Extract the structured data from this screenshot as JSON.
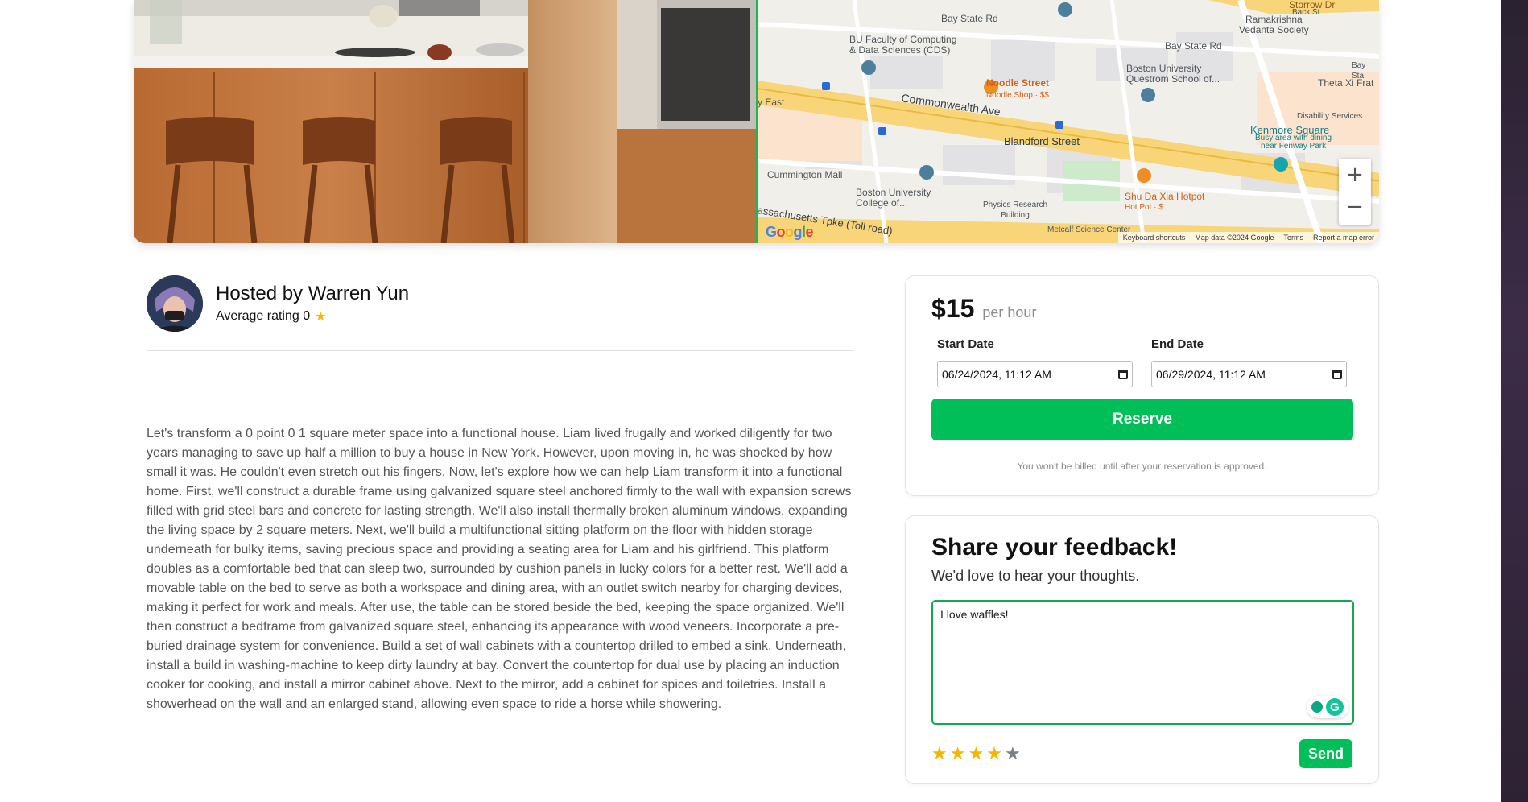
{
  "map": {
    "labels": {
      "bay_state_rd_1": "Bay State Rd",
      "bay_state_rd_2": "Bay State Rd",
      "bay_state_rd_3": "Bay Sta",
      "storrow": "Storrow Dr",
      "back_st": "Back St",
      "ramakrishna": "Ramakrishna\nVedanta Society",
      "bu_cds": "BU Faculty of Computing\n& Data Sciences (CDS)",
      "noodle": "Noodle Street",
      "noodle_sub": "Noodle Shop · $$",
      "questrom": "Boston University\nQuestrom School of...",
      "theta": "Theta Xi Frat",
      "east": "y East",
      "commonwealth": "Commonwealth Ave",
      "disability": "Disability Services",
      "kenmore": "Kenmore Square",
      "kenmore_sub": "Busy area with dining\nnear Fenway Park",
      "blandford": "Blandford Street",
      "cummington": "Cummington Mall",
      "bu_college": "Boston University\nCollege of...",
      "physics": "Physics Research\nBuilding",
      "shu_da": "Shu Da Xia Hotpot",
      "shu_da_sub": "Hot Pot · $",
      "metcalf": "Metcalf Science Center",
      "masspike": "assachusetts Tpke (Toll road)"
    },
    "logo": "Google",
    "footer": [
      "Keyboard shortcuts",
      "Map data ©2024 Google",
      "Terms",
      "Report a map error"
    ],
    "zoom_in": "+",
    "zoom_out": "−"
  },
  "host": {
    "name": "Hosted by Warren Yun",
    "rating_label": "Average rating 0",
    "star": "★"
  },
  "description": "Let's transform a 0 point 0 1 square meter space into a functional house. Liam lived frugally and worked diligently for two years managing to save up half a million to buy a house in New York. However, upon moving in, he was shocked by how small it was. He couldn't even stretch out his fingers. Now, let's explore how we can help Liam transform it into a functional home. First, we'll construct a durable frame using galvanized square steel anchored firmly to the wall with expansion screws filled with grid steel bars and concrete for lasting strength. We'll also install thermally broken aluminum windows, expanding the living space by 2 square meters. Next, we'll build a multifunctional sitting platform on the floor with hidden storage underneath for bulky items, saving precious space and providing a seating area for Liam and his girlfriend. This platform doubles as a comfortable bed that can sleep two, surrounded by cushion panels in lucky colors for a better rest. We'll add a movable table on the bed to serve as both a workspace and dining area, with an outlet switch nearby for charging devices, making it perfect for work and meals. After use, the table can be stored beside the bed, keeping the space organized. We'll then construct a bedframe from galvanized square steel, enhancing its appearance with wood veneers. Incorporate a pre-buried drainage system for convenience. Build a set of wall cabinets with a countertop drilled to embed a sink. Underneath, install a build in washing-machine to keep dirty laundry at bay. Convert the countertop for dual use by placing an induction cooker for cooking, and install a mirror cabinet above. Next to the mirror, add a cabinet for spices and toiletries. Install a showerhead on the wall and an enlarged stand, allowing even space to ride a horse while showering.",
  "reservation": {
    "price": "$15",
    "unit": "per hour",
    "start_label": "Start Date",
    "start_value": "06/24/2024, 11:12 AM",
    "end_label": "End Date",
    "end_value": "06/29/2024, 11:12 AM",
    "reserve_label": "Reserve",
    "note": "You won't be billed until after your reservation is approved."
  },
  "feedback": {
    "title": "Share your feedback!",
    "subtitle": "We'd love to hear your thoughts.",
    "text": "I love waffles!",
    "rating": 4,
    "max_rating": 5,
    "send_label": "Send"
  },
  "colors": {
    "accent": "#00bf58",
    "star": "#f7b500",
    "star_off": "#7b7f86"
  }
}
